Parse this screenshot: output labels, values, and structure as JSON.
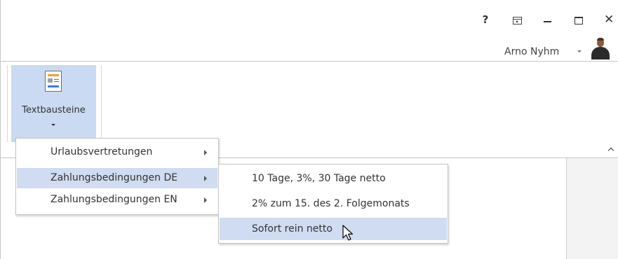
{
  "titlebar": {
    "help_label": "?",
    "close_label": "✕",
    "icons": [
      "question-mark",
      "ribbon-display-options",
      "minimize",
      "maximize",
      "close"
    ]
  },
  "account": {
    "user_name": "Arno Nyhm"
  },
  "ribbon": {
    "button_label": "Textbausteine"
  },
  "menu": {
    "items": [
      {
        "label": "Urlaubsvertretungen"
      },
      {
        "label": "Zahlungsbedingungen DE"
      },
      {
        "label": "Zahlungsbedingungen EN"
      }
    ],
    "highlighted_index": 1
  },
  "submenu": {
    "items": [
      {
        "label": "10 Tage, 3%, 30 Tage netto"
      },
      {
        "label": "2% zum 15. des 2. Folgemonats"
      },
      {
        "label": "Sofort rein netto"
      }
    ],
    "highlighted_index": 2
  },
  "colors": {
    "highlight": "#cfdcf1",
    "ribbon_button_active": "#c9daf2",
    "accent_orange": "#f0a030",
    "accent_blue": "#3a7fd4"
  }
}
